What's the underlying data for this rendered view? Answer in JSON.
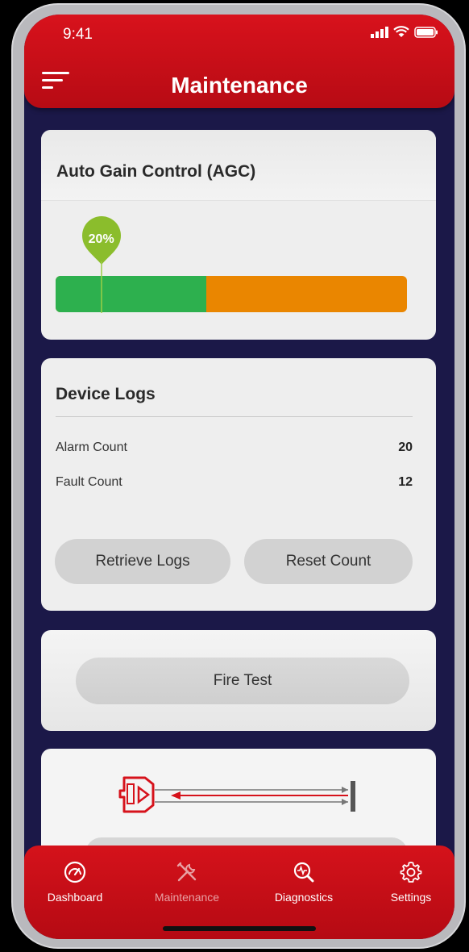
{
  "status_bar": {
    "time": "9:41"
  },
  "header": {
    "title": "Maintenance"
  },
  "agc": {
    "title": "Auto Gain Control (AGC)",
    "level_label": "20%",
    "green_fraction": 0.43,
    "marker_fraction": 0.13,
    "colors": {
      "green": "#2db04e",
      "orange": "#ea8600",
      "pin": "#8bbd2c"
    }
  },
  "device_logs": {
    "title": "Device Logs",
    "rows": [
      {
        "label": "Alarm Count",
        "value": "20"
      },
      {
        "label": "Fault Count",
        "value": "12"
      }
    ],
    "retrieve_label": "Retrieve Logs",
    "reset_label": "Reset Count"
  },
  "fire_test": {
    "label": "Fire Test"
  },
  "tabs": [
    {
      "label": "Dashboard",
      "icon": "speedometer-icon",
      "active": true
    },
    {
      "label": "Maintenance",
      "icon": "tools-icon",
      "active": false
    },
    {
      "label": "Diagnostics",
      "icon": "diagnostics-search-icon",
      "active": true
    },
    {
      "label": "Settings",
      "icon": "gear-icon",
      "active": true
    }
  ],
  "colors": {
    "header_red": "#d5121b",
    "background": "#1b1848"
  }
}
